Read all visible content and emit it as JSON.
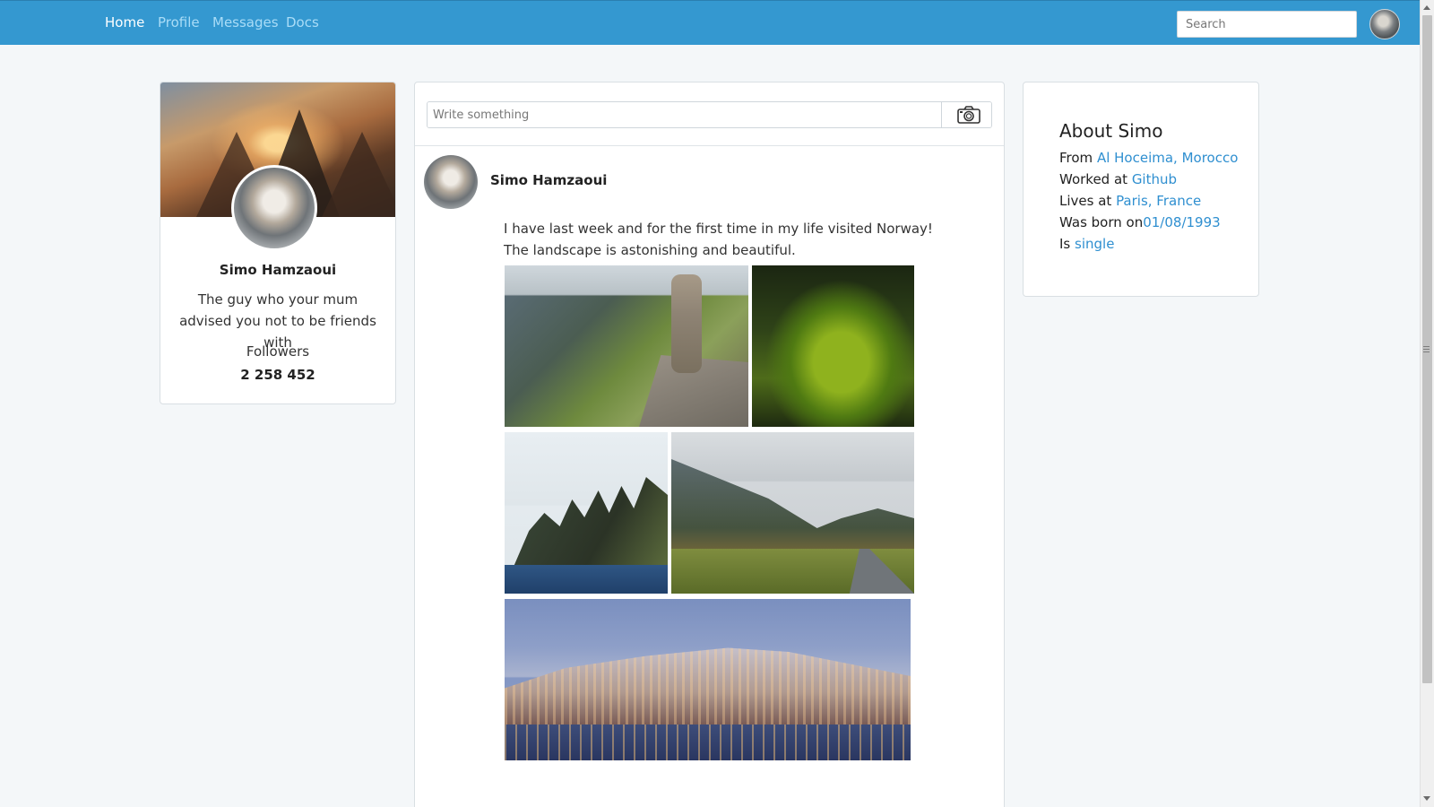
{
  "navbar": {
    "links": [
      {
        "label": "Home",
        "active": true
      },
      {
        "label": "Profile",
        "active": false
      },
      {
        "label": "Messages",
        "active": false
      },
      {
        "label": "Docs",
        "active": false
      }
    ],
    "search_placeholder": "Search",
    "color": "#3498d0"
  },
  "profile": {
    "name": "Simo Hamzaoui",
    "bio": "The guy who your mum advised you not to be friends with",
    "followers_label": "Followers",
    "followers_count": "2 258 452"
  },
  "composer": {
    "placeholder": "Write something",
    "camera_icon": "camera-icon"
  },
  "post": {
    "author": "Simo Hamzaoui",
    "text": "I have last week and for the first time in my life visited Norway! The landscape is astonishing and beautiful."
  },
  "about": {
    "title": "About Simo",
    "from_label": "From ",
    "from_value": "Al Hoceima, Morocco",
    "worked_label": "Worked at ",
    "worked_value": "Github",
    "lives_label": "Lives at ",
    "lives_value": "Paris, France",
    "born_label": "Was born on",
    "born_value": "01/08/1993",
    "status_label": "Is ",
    "status_value": "single",
    "link_color": "#2f8fd0"
  }
}
